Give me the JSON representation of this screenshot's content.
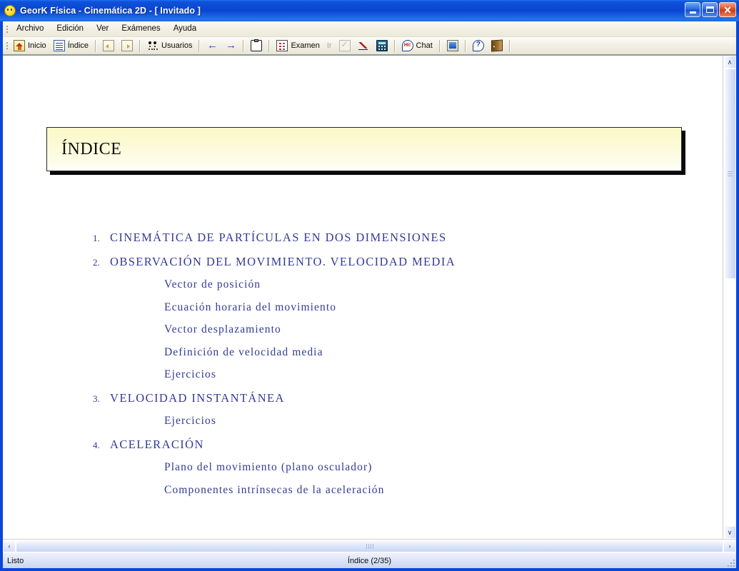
{
  "window": {
    "title": "GeorK Física - Cinemática 2D - [ Invitado ]",
    "icon": "smiley-face-icon",
    "buttons": {
      "minimize": "_",
      "maximize": "□",
      "close": "✕"
    }
  },
  "menubar": {
    "items": [
      {
        "label": "Archivo"
      },
      {
        "label": "Edición"
      },
      {
        "label": "Ver"
      },
      {
        "label": "Exámenes"
      },
      {
        "label": "Ayuda"
      }
    ]
  },
  "toolbar": {
    "items": [
      {
        "label": "Inicio",
        "icon": "home-icon",
        "disabled": false
      },
      {
        "label": "Índice",
        "icon": "document-icon",
        "disabled": false
      },
      {
        "label": "",
        "icon": "page-back-icon",
        "disabled": false
      },
      {
        "label": "",
        "icon": "page-forward-icon",
        "disabled": false
      },
      {
        "label": "Usuarios",
        "icon": "users-icon",
        "disabled": false
      },
      {
        "label": "",
        "icon": "arrow-left-icon",
        "disabled": false
      },
      {
        "label": "",
        "icon": "arrow-right-icon",
        "disabled": false
      },
      {
        "label": "",
        "icon": "clipboard-icon",
        "disabled": false
      },
      {
        "label": "Examen",
        "icon": "exam-list-icon",
        "disabled": false
      },
      {
        "label": "Ir",
        "icon": "",
        "disabled": true
      },
      {
        "label": "",
        "icon": "checklist-icon",
        "disabled": true
      },
      {
        "label": "",
        "icon": "graph-icon",
        "disabled": false
      },
      {
        "label": "",
        "icon": "calculator-icon",
        "disabled": false
      },
      {
        "label": "Chat",
        "icon": "chat-bubble-icon",
        "disabled": false
      },
      {
        "label": "",
        "icon": "screen-icon",
        "disabled": false
      },
      {
        "label": "",
        "icon": "help-icon",
        "disabled": false
      },
      {
        "label": "",
        "icon": "exit-door-icon",
        "disabled": false
      }
    ],
    "chat_badge": "Hi!",
    "help_glyph": "?"
  },
  "document": {
    "heading": "ÍNDICE",
    "toc": [
      {
        "type": "chapter",
        "num": "1.",
        "text": "CINEMÁTICA  DE  PARTÍCULAS  EN  DOS  DIMENSIONES"
      },
      {
        "type": "chapter",
        "num": "2.",
        "text": "OBSERVACIÓN  DEL  MOVIMIENTO.  VELOCIDAD  MEDIA"
      },
      {
        "type": "sub",
        "num": "",
        "text": "Vector  de  posición"
      },
      {
        "type": "sub",
        "num": "",
        "text": "Ecuación  horaria  del  movimiento"
      },
      {
        "type": "sub",
        "num": "",
        "text": "Vector  desplazamiento"
      },
      {
        "type": "sub",
        "num": "",
        "text": "Definición  de  velocidad  media"
      },
      {
        "type": "sub",
        "num": "",
        "text": "Ejercicios"
      },
      {
        "type": "chapter",
        "num": "3.",
        "text": "VELOCIDAD  INSTANTÁNEA"
      },
      {
        "type": "sub",
        "num": "",
        "text": "Ejercicios"
      },
      {
        "type": "chapter",
        "num": "4.",
        "text": "ACELERACIÓN"
      },
      {
        "type": "sub",
        "num": "",
        "text": "Plano  del  movimiento  (plano  osculador)"
      },
      {
        "type": "sub",
        "num": "",
        "text": "Componentes  intrínsecas  de  la  aceleración"
      }
    ]
  },
  "scrollbars": {
    "vertical": {
      "up": "∧",
      "down": "∨",
      "thumb_top_pct": 0,
      "thumb_height_pct": 46
    },
    "horizontal": {
      "left": "‹",
      "right": "›"
    }
  },
  "statusbar": {
    "left": "Listo",
    "center": "Índice  (2/35)"
  },
  "colors": {
    "titlebar_blue": "#0a44cf",
    "window_border": "#0a46d8",
    "toc_text": "#333b96",
    "indice_box_fill": "#fbf8c8",
    "close_button": "#c8401a"
  }
}
